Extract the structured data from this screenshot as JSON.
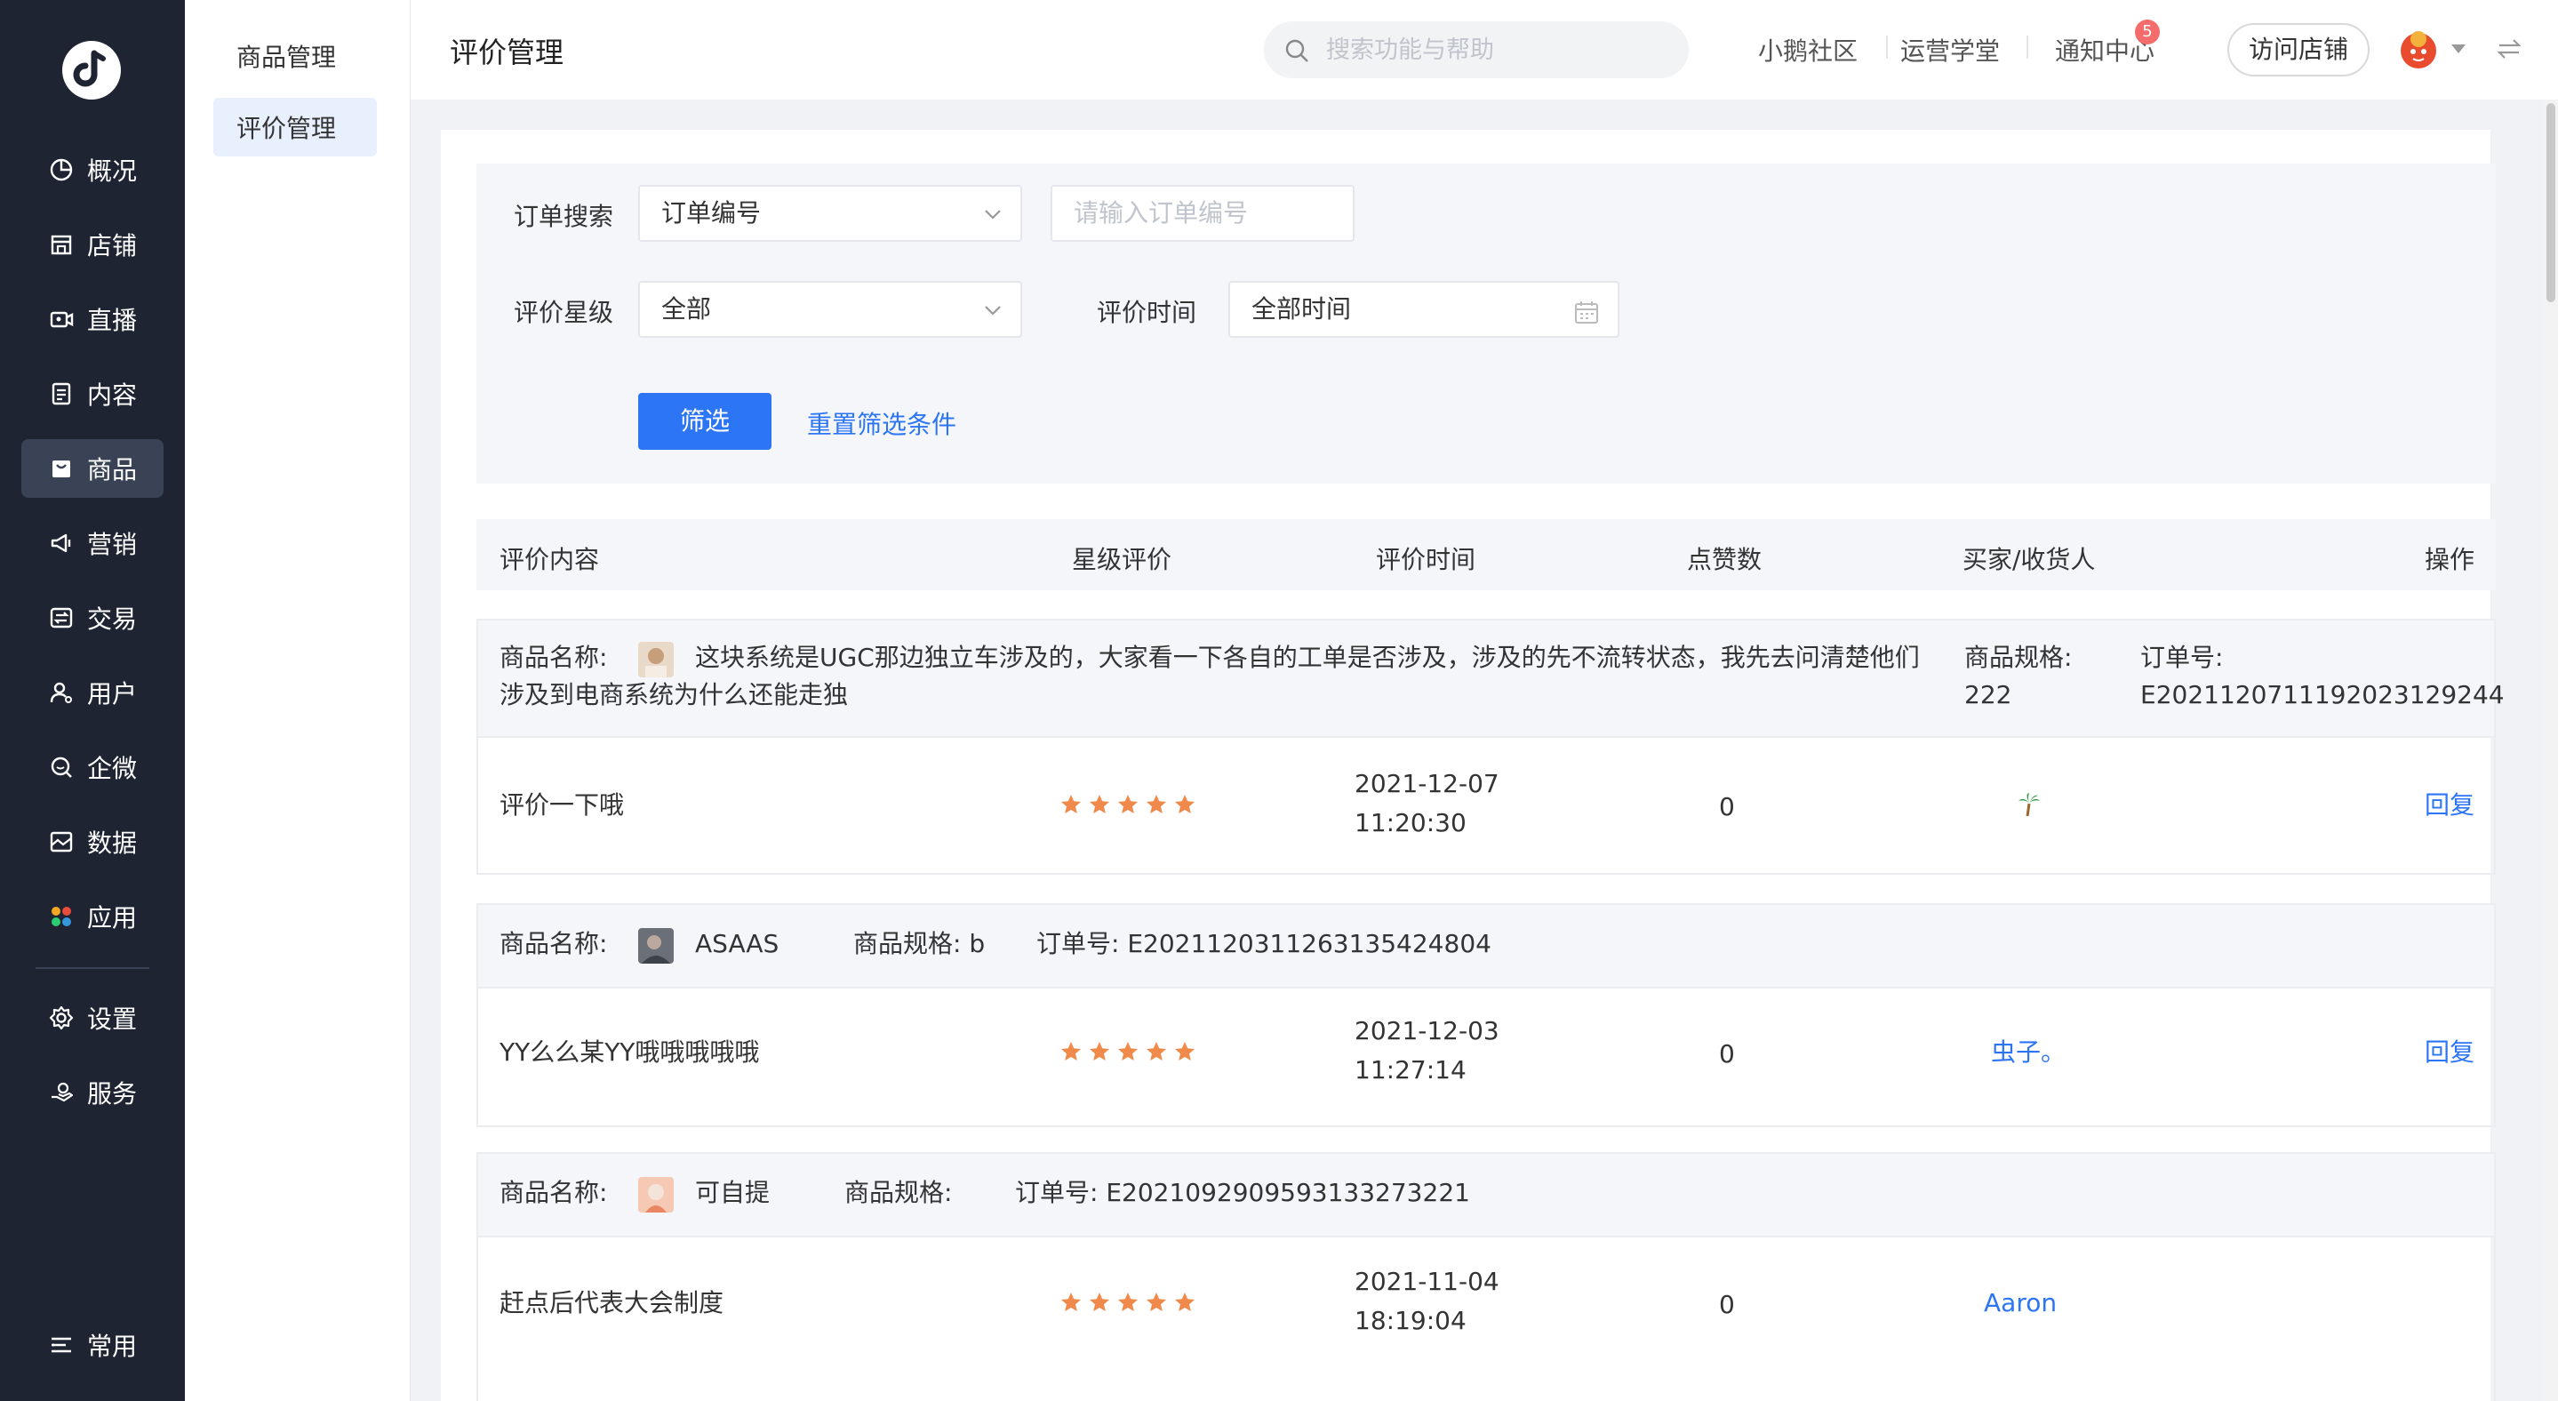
{
  "nav": {
    "items": [
      {
        "label": "概况",
        "icon": "pie-chart-icon"
      },
      {
        "label": "店铺",
        "icon": "store-icon"
      },
      {
        "label": "直播",
        "icon": "live-video-icon"
      },
      {
        "label": "内容",
        "icon": "document-icon"
      },
      {
        "label": "商品",
        "icon": "shopping-bag-icon",
        "active": true
      },
      {
        "label": "营销",
        "icon": "megaphone-icon"
      },
      {
        "label": "交易",
        "icon": "exchange-icon"
      },
      {
        "label": "用户",
        "icon": "user-icon"
      },
      {
        "label": "企微",
        "icon": "chat-bubble-icon"
      },
      {
        "label": "数据",
        "icon": "data-image-icon"
      },
      {
        "label": "应用",
        "icon": "apps-grid-icon"
      }
    ],
    "bottom_items": [
      {
        "label": "设置",
        "icon": "gear-icon"
      },
      {
        "label": "服务",
        "icon": "service-hand-icon"
      }
    ],
    "footer_label": "常用"
  },
  "subnav": {
    "items": [
      {
        "label": "商品管理"
      },
      {
        "label": "评价管理",
        "active": true
      }
    ]
  },
  "header": {
    "title": "评价管理",
    "search_placeholder": "搜索功能与帮助",
    "links": [
      "小鹅社区",
      "运营学堂",
      "通知中心"
    ],
    "notification_count": "5",
    "visit_store": "访问店铺"
  },
  "filter": {
    "order_search_label": "订单搜索",
    "order_type_value": "订单编号",
    "order_input_placeholder": "请输入订单编号",
    "rating_label": "评价星级",
    "rating_value": "全部",
    "time_label": "评价时间",
    "time_value": "全部时间",
    "submit": "筛选",
    "reset": "重置筛选条件"
  },
  "table": {
    "columns": [
      "评价内容",
      "星级评价",
      "评价时间",
      "点赞数",
      "买家/收货人",
      "操作"
    ],
    "groups": [
      {
        "product_label": "商品名称:",
        "product_name_line1": "这块系统是UGC那边独立车涉及的，大家看一下各自的工单是否涉及，涉及的先不流转状态，我先去问清楚他们",
        "product_name_line2": "涉及到电商系统为什么还能走独",
        "spec_label": "商品规格:",
        "spec_value": "222",
        "order_label": "订单号:",
        "order_no": "E20211207111920231292​44",
        "review": "评价一下哦",
        "stars": 5,
        "date": "2021-12-07",
        "time": "11:20:30",
        "likes": "0",
        "buyer": "",
        "buyer_icon": "palm-tree-icon",
        "action": "回复"
      },
      {
        "product_label": "商品名称:",
        "product_name": "ASAAS",
        "spec_text": "商品规格: b",
        "order_text": "订单号: E20211203112631354248​04",
        "review": "YY么么某YY哦哦哦哦哦",
        "stars": 5,
        "date": "2021-12-03",
        "time": "11:27:14",
        "likes": "0",
        "buyer": "虫子。",
        "action": "回复"
      },
      {
        "product_label": "商品名称:",
        "product_name": "可自提",
        "spec_text": "商品规格:",
        "order_text": "订单号: E20210929095931332732​21",
        "review": "赶点后代表大会制度",
        "stars": 5,
        "date": "2021-11-04",
        "time": "18:19:04",
        "likes": "0",
        "buyer": "Aaron",
        "action": ""
      }
    ]
  },
  "colors": {
    "nav_bg": "#1f2433",
    "primary": "#2c75f5",
    "star": "#f08a4b",
    "badge": "#f56c6c"
  }
}
